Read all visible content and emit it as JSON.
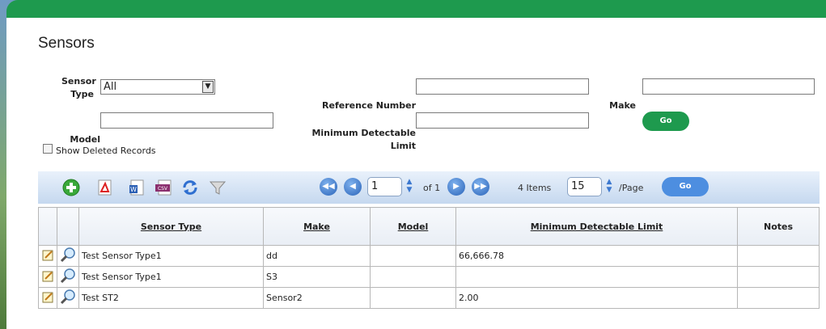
{
  "page_title": "Sensors",
  "filters": {
    "sensor_type_label": "Sensor Type",
    "sensor_type_value": "All",
    "reference_number_label": "Reference Number",
    "reference_number_value": "",
    "make_label": "Make",
    "make_value": "",
    "model_label": "Model",
    "model_value": "",
    "min_limit_label": "Minimum Detectable Limit",
    "min_limit_value": "",
    "go_label": "Go",
    "show_deleted_label": "Show Deleted Records",
    "show_deleted_checked": false
  },
  "toolbar": {
    "icons": [
      "add-icon",
      "pdf-export-icon",
      "word-export-icon",
      "csv-export-icon",
      "refresh-icon",
      "filter-icon"
    ],
    "current_page": "1",
    "page_of": "of 1",
    "items_count": "4 Items",
    "page_size": "15",
    "per_page": "/Page",
    "go_label": "Go"
  },
  "table": {
    "columns": [
      "Sensor Type",
      "Make",
      "Model",
      "Minimum Detectable Limit",
      "Notes"
    ],
    "rows": [
      {
        "sensor_type": "Test Sensor Type1",
        "make": "dd",
        "model": "",
        "min_limit": "66,666.78",
        "notes": ""
      },
      {
        "sensor_type": "Test Sensor Type1",
        "make": "S3",
        "model": "",
        "min_limit": "",
        "notes": ""
      },
      {
        "sensor_type": "Test ST2",
        "make": "Sensor2",
        "model": "",
        "min_limit": "2.00",
        "notes": ""
      }
    ]
  },
  "colors": {
    "brand_green": "#1e9a4e",
    "pager_blue": "#2a63b8",
    "go_blue": "#4d8ee0"
  }
}
